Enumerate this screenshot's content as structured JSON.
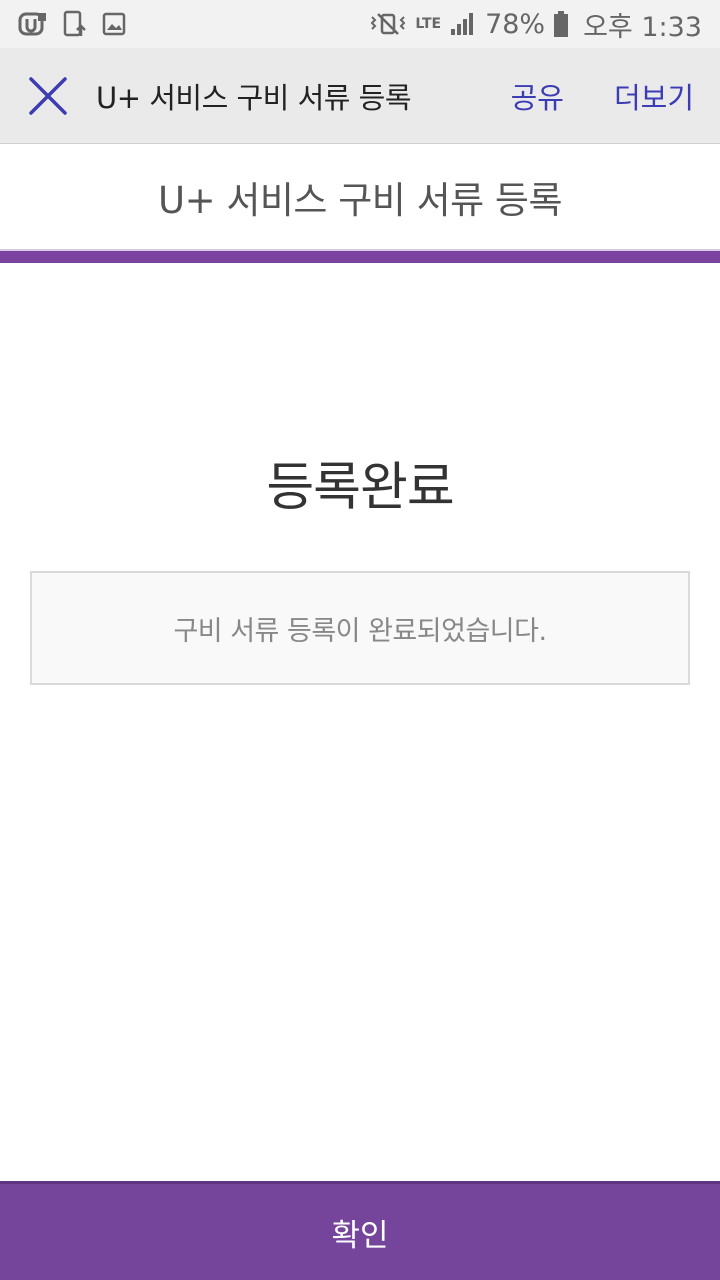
{
  "status_bar": {
    "left_icons": [
      "uplus-app-icon",
      "phone-update-icon",
      "gallery-icon"
    ],
    "right_icons": [
      "vibrate-icon",
      "lte-icon",
      "signal-icon",
      "battery-icon"
    ],
    "lte_label": "LTE",
    "battery": "78%",
    "time": "오후 1:33"
  },
  "app_bar": {
    "title": "U+ 서비스 구비 서류 등록",
    "share_label": "공유",
    "more_label": "더보기",
    "accent_color": "#3c3cb4"
  },
  "page": {
    "header": "U+ 서비스 구비 서류 등록",
    "complete_title": "등록완료",
    "message": "구비 서류 등록이 완료되었습니다.",
    "brand_color": "#75449b"
  },
  "footer": {
    "confirm_label": "확인"
  }
}
